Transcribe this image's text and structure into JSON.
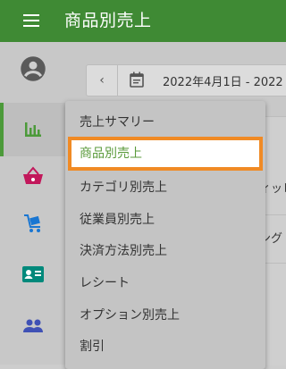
{
  "appbar": {
    "title": "商品別売上"
  },
  "rail": {
    "items": [
      "account",
      "analytics",
      "basket",
      "cart",
      "id-card",
      "people"
    ]
  },
  "datebar": {
    "prev": "‹",
    "range": "2022年4月1日 - 2022"
  },
  "background": {
    "frag1": "ィッレ",
    "frag2": "ング"
  },
  "menu": {
    "items": [
      "売上サマリー",
      "商品別売上",
      "カテゴリ別売上",
      "従業員別売上",
      "決済方法別売上",
      "レシート",
      "オプション別売上",
      "割引"
    ],
    "selected_index": 1
  },
  "colors": {
    "brand": "#3f8a34",
    "highlight": "#f08a24"
  }
}
